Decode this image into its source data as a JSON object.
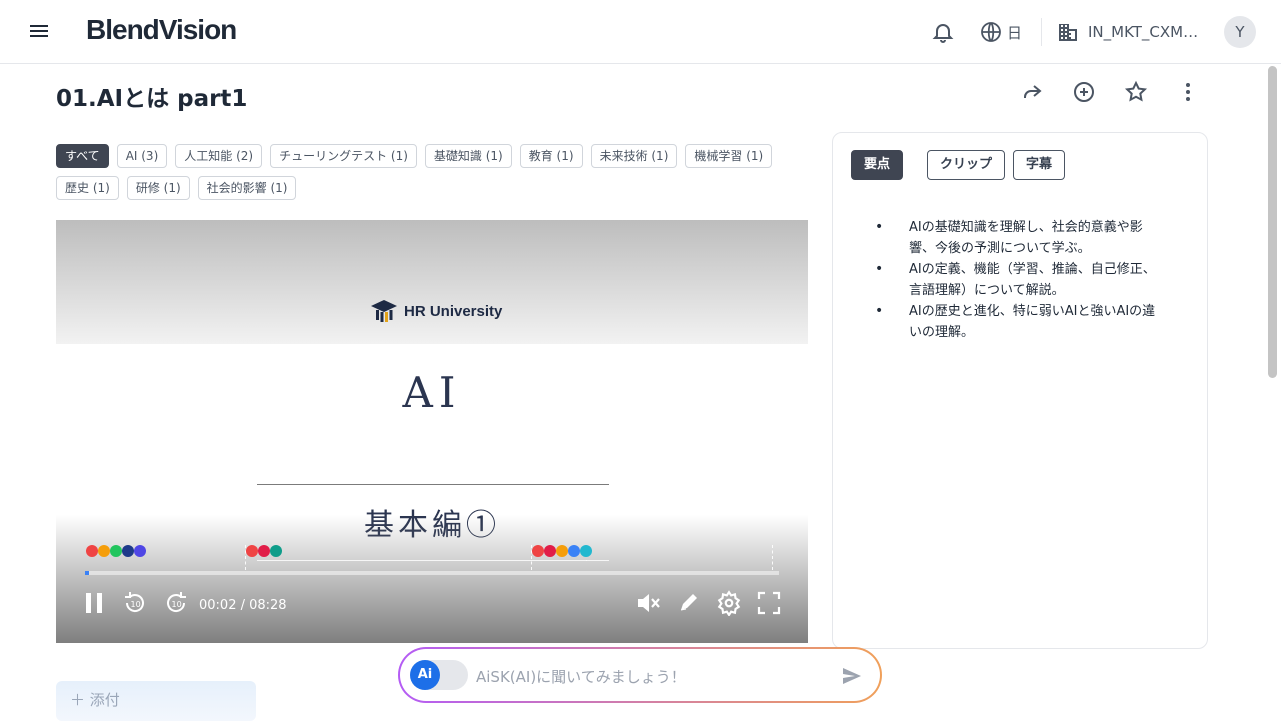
{
  "header": {
    "brand": "BlendVision",
    "menu_icon": "hamburger-icon",
    "notification_icon": "bell-icon",
    "language_icon": "globe-icon",
    "language_label": "日",
    "org_icon": "building-icon",
    "org_label": "IN_MKT_CXM…",
    "avatar_initial": "Y"
  },
  "page": {
    "title": "01.AIとは part1",
    "actions": [
      "share-icon",
      "add-circle-icon",
      "star-icon",
      "more-vert-icon"
    ]
  },
  "tags": [
    {
      "label": "すべて",
      "active": true
    },
    {
      "label": "AI (3)",
      "active": false
    },
    {
      "label": "人工知能 (2)",
      "active": false
    },
    {
      "label": "チューリングテスト (1)",
      "active": false
    },
    {
      "label": "基礎知識 (1)",
      "active": false
    },
    {
      "label": "教育 (1)",
      "active": false
    },
    {
      "label": "未来技術 (1)",
      "active": false
    },
    {
      "label": "機械学習 (1)",
      "active": false
    },
    {
      "label": "歴史 (1)",
      "active": false
    },
    {
      "label": "研修 (1)",
      "active": false
    },
    {
      "label": "社会的影響 (1)",
      "active": false
    }
  ],
  "video": {
    "org_logo_text": "HR University",
    "slide_title": "AI",
    "slide_subtitle": "基本編①",
    "current_time": "00:02",
    "duration": "08:28",
    "time_display": "00:02 / 08:28",
    "progress_fraction": 0.004,
    "marker_groups": [
      {
        "colors": [
          "#ef4444",
          "#f59e0b",
          "#22c55e",
          "#1e3a8a",
          "#4f46e5"
        ]
      },
      {
        "colors": [
          "#ef4444",
          "#e11d48",
          "#0f9d8a"
        ]
      },
      {
        "colors": [
          "#ef4444",
          "#e11d48",
          "#f59e0b",
          "#3b82f6",
          "#22b8cf"
        ]
      }
    ],
    "controls": [
      "pause-icon",
      "rewind-10-icon",
      "forward-10-icon",
      "mute-icon",
      "pen-icon",
      "settings-icon",
      "fullscreen-icon"
    ]
  },
  "panel": {
    "tabs": [
      {
        "label": "要点",
        "active": true
      },
      {
        "label": "クリップ",
        "active": false
      },
      {
        "label": "字幕",
        "active": false
      }
    ],
    "points": [
      "AIの基礎知識を理解し、社会的意義や影響、今後の予測について学ぶ。",
      "AIの定義、機能（学習、推論、自己修正、言語理解）について解説。",
      "AIの歴史と進化、特に弱いAIと強いAIの違いの理解。"
    ]
  },
  "bottom": {
    "attach_label": "＋ 添付",
    "ai_badge": "Ai",
    "ai_placeholder": "AiSK(AI)に聞いてみましょう！",
    "send_icon": "send-icon"
  },
  "colors": {
    "accent_dark": "#3f4552",
    "progress": "#3b82f6",
    "ai_blue": "#1d6fe8",
    "ai_gradient_start": "#b45cf5",
    "ai_gradient_end": "#f0a05a"
  }
}
